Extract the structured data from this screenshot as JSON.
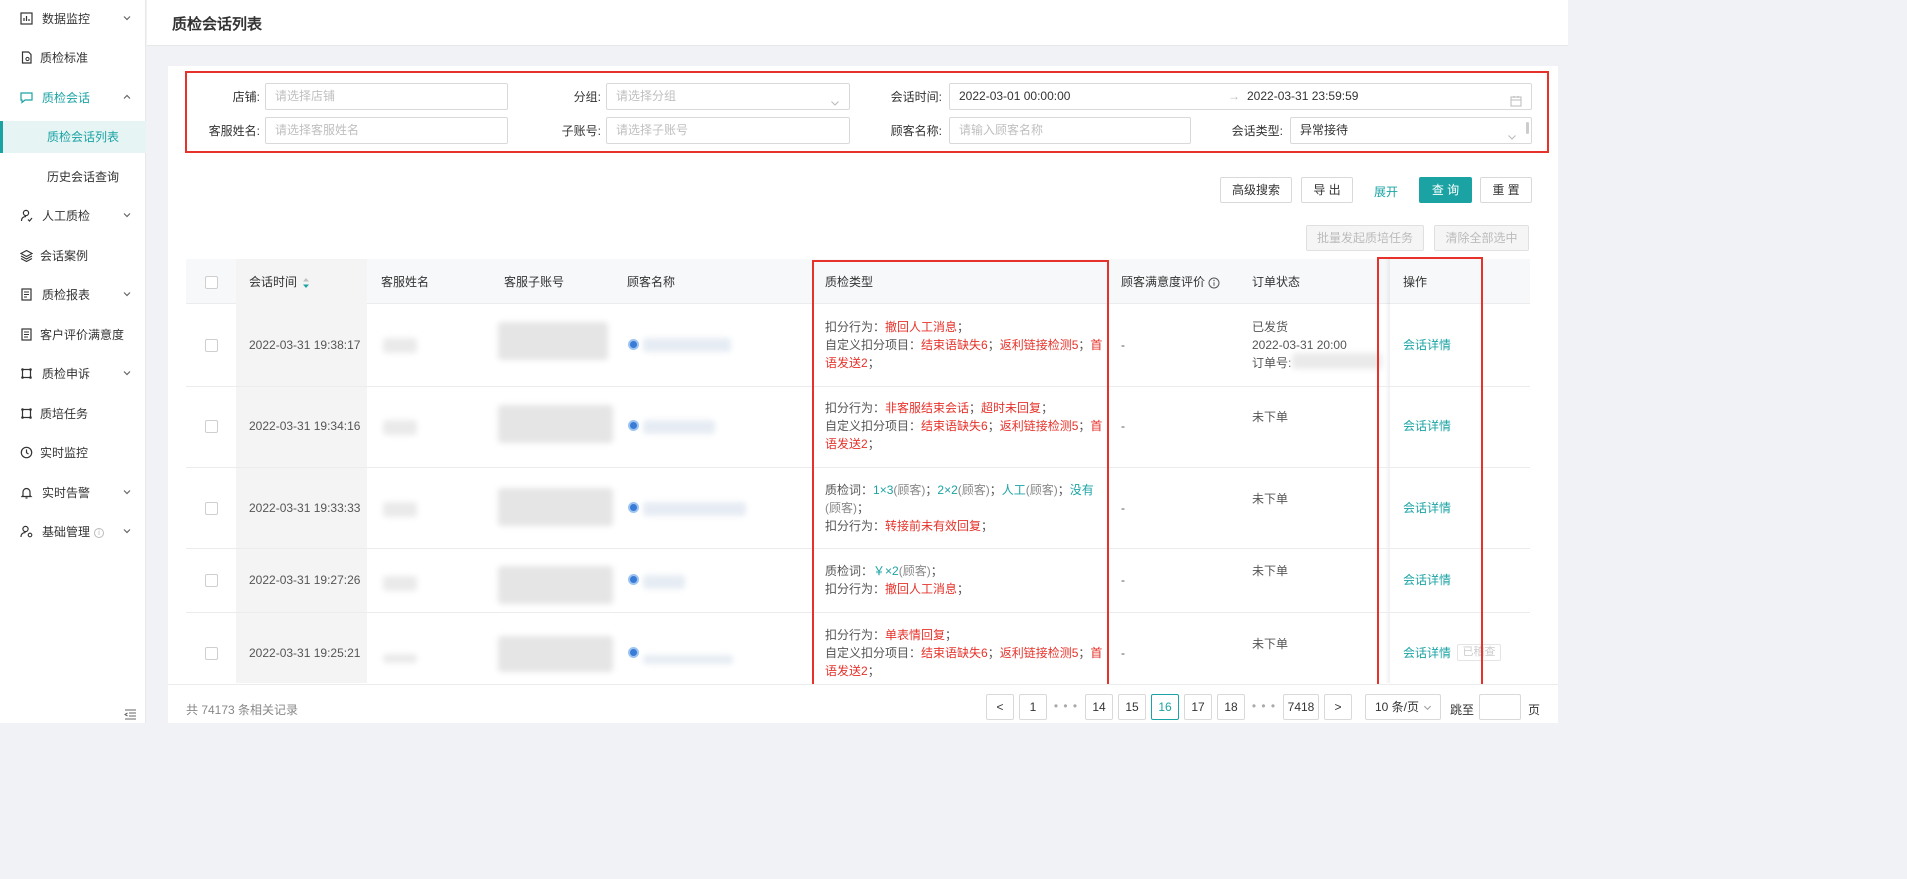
{
  "sidebar": {
    "items": [
      {
        "label": "数据监控",
        "icon": "chart-icon",
        "chevron": "down"
      },
      {
        "label": "质检标准",
        "icon": "document-icon"
      },
      {
        "label": "质检会话",
        "icon": "chat-icon",
        "chevron": "up"
      },
      {
        "label": "质检会话列表"
      },
      {
        "label": "历史会话查询"
      },
      {
        "label": "人工质检",
        "icon": "person-icon",
        "chevron": "down"
      },
      {
        "label": "会话案例",
        "icon": "layers-icon"
      },
      {
        "label": "质检报表",
        "icon": "report-icon",
        "chevron": "down"
      },
      {
        "label": "客户评价满意度",
        "icon": "rating-icon"
      },
      {
        "label": "质检申诉",
        "icon": "appeal-icon",
        "chevron": "down"
      },
      {
        "label": "质培任务",
        "icon": "training-icon"
      },
      {
        "label": "实时监控",
        "icon": "clock-icon"
      },
      {
        "label": "实时告警",
        "icon": "bell-icon",
        "chevron": "down"
      },
      {
        "label": "基础管理",
        "icon": "admin-icon",
        "chevron": "down",
        "info": "i"
      }
    ]
  },
  "header": {
    "title": "质检会话列表"
  },
  "filters": {
    "shop": {
      "label": "店铺:",
      "placeholder": "请选择店铺"
    },
    "group": {
      "label": "分组:",
      "placeholder": "请选择分组"
    },
    "session_time": {
      "label": "会话时间:",
      "start": "2022-03-01 00:00:00",
      "separator": "→",
      "end": "2022-03-31 23:59:59"
    },
    "agent_name": {
      "label": "客服姓名:",
      "placeholder": "请选择客服姓名"
    },
    "sub_account": {
      "label": "子账号:",
      "placeholder": "请选择子账号"
    },
    "customer_name": {
      "label": "顾客名称:",
      "placeholder": "请输入顾客名称"
    },
    "session_type": {
      "label": "会话类型:",
      "value": "异常接待"
    }
  },
  "actions": {
    "advanced": "高级搜索",
    "export": "导 出",
    "expand": "展开",
    "query": "查 询",
    "reset": "重 置",
    "batch_training": "批量发起质培任务",
    "clear_selection": "清除全部选中"
  },
  "table": {
    "columns": {
      "time": "会话时间",
      "agent": "客服姓名",
      "sub_account": "客服子账号",
      "customer": "顾客名称",
      "qc_type": "质检类型",
      "satisfaction": "顾客满意度评价",
      "order_status": "订单状态",
      "operation": "操作"
    },
    "rows": [
      {
        "time": "2022-03-31 19:38:17",
        "satisfaction": "-",
        "order": [
          "已发货",
          "2022-03-31 20:00",
          "订单号:"
        ],
        "op": "会话详情",
        "qc": [
          [
            {
              "t": "扣分行为：",
              "c": "k"
            },
            {
              "t": "撤回人工消息",
              "c": "r"
            },
            {
              "t": "；",
              "c": "k"
            }
          ],
          [
            {
              "t": "自定义扣分项目：",
              "c": "k"
            },
            {
              "t": "结束语缺失6",
              "c": "r"
            },
            {
              "t": "；",
              "c": "k"
            },
            {
              "t": "返利链接检测5",
              "c": "r"
            },
            {
              "t": "；",
              "c": "k"
            },
            {
              "t": "首",
              "c": "r"
            }
          ],
          [
            {
              "t": "语发送2",
              "c": "r"
            },
            {
              "t": "；",
              "c": "k"
            }
          ]
        ]
      },
      {
        "time": "2022-03-31 19:34:16",
        "satisfaction": "-",
        "order": [
          "未下单"
        ],
        "op": "会话详情",
        "qc": [
          [
            {
              "t": "扣分行为：",
              "c": "k"
            },
            {
              "t": "非客服结束会话",
              "c": "r"
            },
            {
              "t": "；",
              "c": "k"
            },
            {
              "t": "超时未回复",
              "c": "r"
            },
            {
              "t": "；",
              "c": "k"
            }
          ],
          [
            {
              "t": "自定义扣分项目：",
              "c": "k"
            },
            {
              "t": "结束语缺失6",
              "c": "r"
            },
            {
              "t": "；",
              "c": "k"
            },
            {
              "t": "返利链接检测5",
              "c": "r"
            },
            {
              "t": "；",
              "c": "k"
            },
            {
              "t": "首",
              "c": "r"
            }
          ],
          [
            {
              "t": "语发送2",
              "c": "r"
            },
            {
              "t": "；",
              "c": "k"
            }
          ]
        ]
      },
      {
        "time": "2022-03-31 19:33:33",
        "satisfaction": "-",
        "order": [
          "未下单"
        ],
        "op": "会话详情",
        "qc": [
          [
            {
              "t": "质检词：",
              "c": "k"
            },
            {
              "t": "1×3",
              "c": "t"
            },
            {
              "t": "(顾客)",
              "c": "g"
            },
            {
              "t": "；",
              "c": "k"
            },
            {
              "t": "2×2",
              "c": "t"
            },
            {
              "t": "(顾客)",
              "c": "g"
            },
            {
              "t": "；",
              "c": "k"
            },
            {
              "t": "人工",
              "c": "t"
            },
            {
              "t": "(顾客)",
              "c": "g"
            },
            {
              "t": "；",
              "c": "k"
            },
            {
              "t": "没有",
              "c": "t"
            }
          ],
          [
            {
              "t": "(顾客)",
              "c": "g"
            },
            {
              "t": "；",
              "c": "k"
            }
          ],
          [
            {
              "t": "扣分行为：",
              "c": "k"
            },
            {
              "t": "转接前未有效回复",
              "c": "r"
            },
            {
              "t": "；",
              "c": "k"
            }
          ]
        ]
      },
      {
        "time": "2022-03-31 19:27:26",
        "satisfaction": "-",
        "order": [
          "未下单"
        ],
        "op": "会话详情",
        "qc": [
          [
            {
              "t": "质检词：",
              "c": "k"
            },
            {
              "t": "￥×2",
              "c": "t"
            },
            {
              "t": "(顾客)",
              "c": "g"
            },
            {
              "t": "；",
              "c": "k"
            }
          ],
          [
            {
              "t": "扣分行为：",
              "c": "k"
            },
            {
              "t": "撤回人工消息",
              "c": "r"
            },
            {
              "t": "；",
              "c": "k"
            }
          ]
        ]
      },
      {
        "time": "2022-03-31 19:25:21",
        "satisfaction": "-",
        "order": [
          "未下单"
        ],
        "op": "会话详情",
        "op2": "已稽查",
        "qc": [
          [
            {
              "t": "扣分行为：",
              "c": "k"
            },
            {
              "t": "单表情回复",
              "c": "r"
            },
            {
              "t": "；",
              "c": "k"
            }
          ],
          [
            {
              "t": "自定义扣分项目：",
              "c": "k"
            },
            {
              "t": "结束语缺失6",
              "c": "r"
            },
            {
              "t": "；",
              "c": "k"
            },
            {
              "t": "返利链接检测5",
              "c": "r"
            },
            {
              "t": "；",
              "c": "k"
            },
            {
              "t": "首",
              "c": "r"
            }
          ],
          [
            {
              "t": "语发送2",
              "c": "r"
            },
            {
              "t": "；",
              "c": "k"
            }
          ]
        ]
      }
    ]
  },
  "pagination": {
    "total": "共 74173 条相关记录",
    "prev": "<",
    "next": ">",
    "first": "1",
    "ellipsis": "• • •",
    "pages": [
      "14",
      "15",
      "16",
      "17",
      "18"
    ],
    "current": "16",
    "last": "7418",
    "page_size": "10 条/页",
    "jump_label": "跳至",
    "page_suffix": "页"
  },
  "colors": {
    "accent": "#1ba3a4",
    "alert": "#e6322a"
  }
}
